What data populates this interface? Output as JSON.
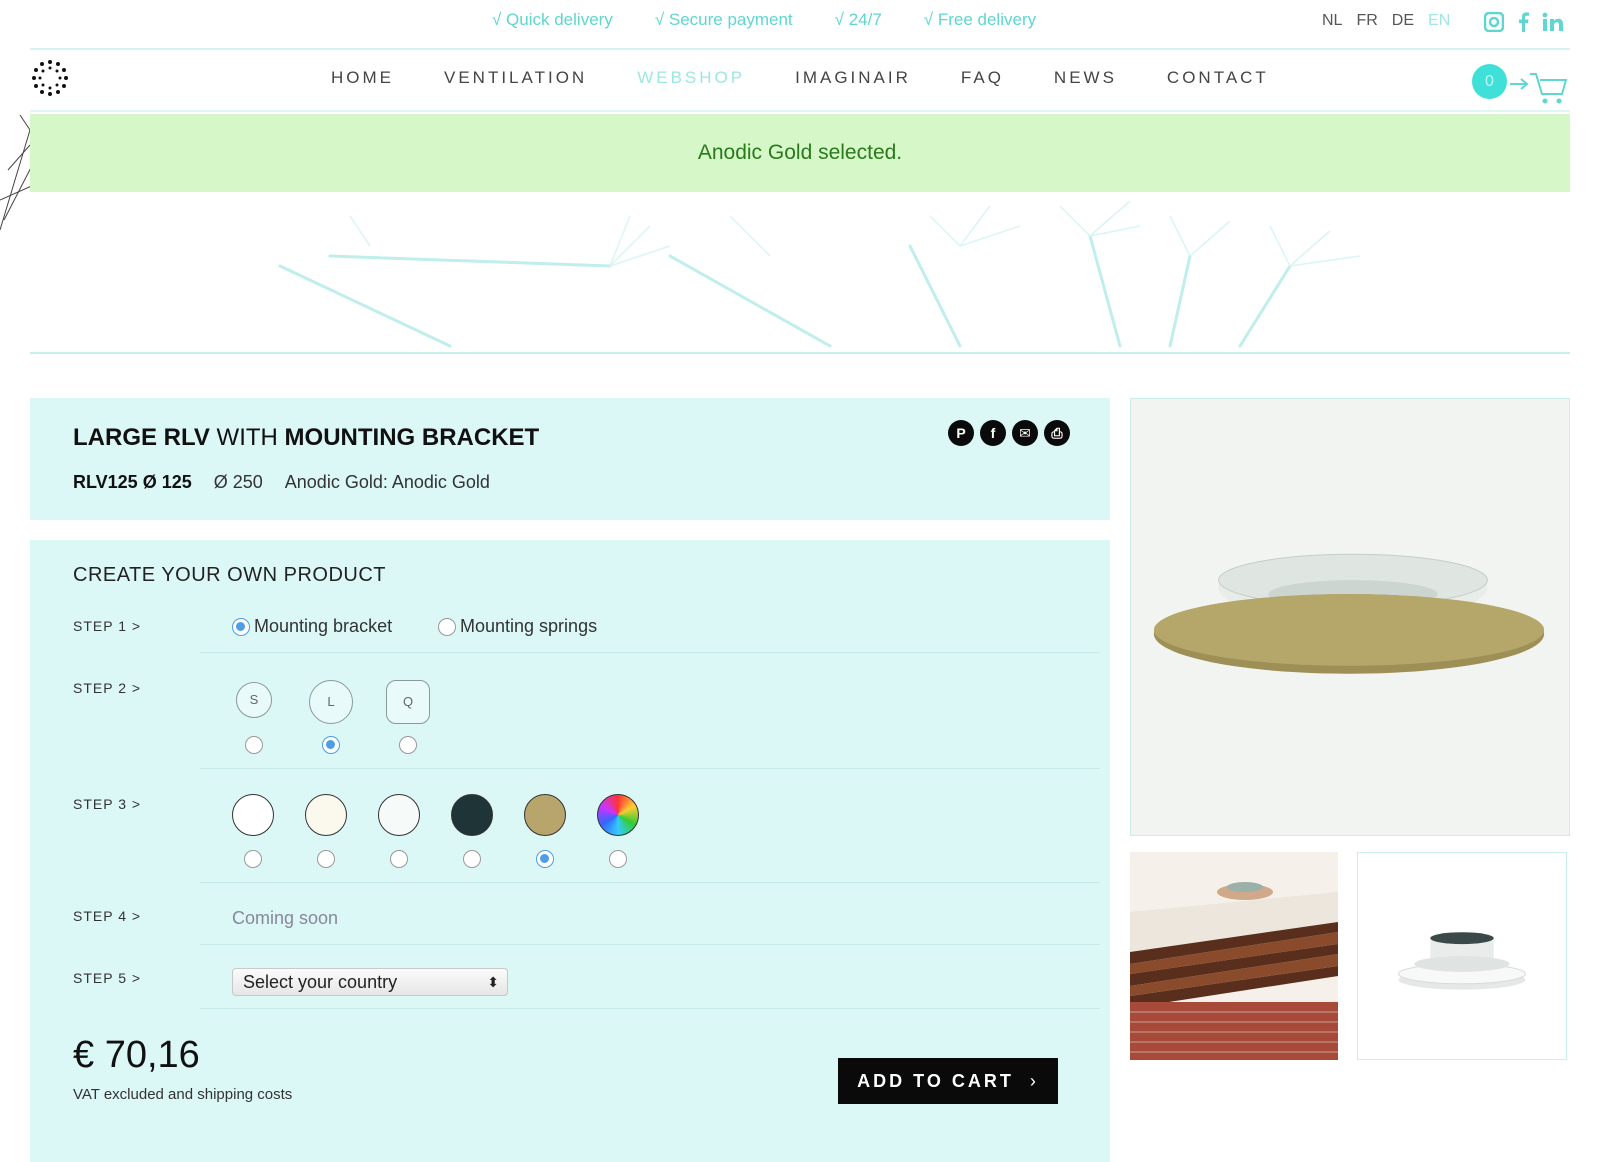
{
  "topbar": {
    "usps": [
      "√ Quick delivery",
      "√ Secure payment",
      "√ 24/7",
      "√ Free delivery"
    ],
    "languages": [
      "NL",
      "FR",
      "DE",
      "EN"
    ],
    "active_language": "EN",
    "social_icons": [
      "instagram-icon",
      "facebook-icon",
      "linkedin-icon"
    ]
  },
  "nav": {
    "items": [
      "HOME",
      "VENTILATION",
      "WEBSHOP",
      "IMAGINAIR",
      "FAQ",
      "NEWS",
      "CONTACT"
    ],
    "active": "WEBSHOP",
    "cart_count": "0"
  },
  "alert": {
    "message": "Anodic Gold selected."
  },
  "product": {
    "title_part1": "LARGE RLV",
    "title_part2": " WITH ",
    "title_part3": "MOUNTING BRACKET",
    "code": "RLV125 Ø 125",
    "diameter": "Ø 250",
    "finish": "Anodic Gold: Anodic Gold",
    "share_icons": [
      "pinterest-icon",
      "facebook-icon",
      "mail-icon",
      "print-icon"
    ]
  },
  "configurator": {
    "title": "CREATE YOUR OWN PRODUCT",
    "step1": {
      "label": "STEP 1 >",
      "options": [
        "Mounting bracket",
        "Mounting springs"
      ],
      "selected": 0
    },
    "step2": {
      "label": "STEP 2 >",
      "options": [
        "S",
        "L",
        "Q"
      ],
      "selected": 1
    },
    "step3": {
      "label": "STEP 3 >",
      "swatches": [
        "#ffffff",
        "#fbf8ee",
        "#f6fbfa",
        "#1f3437",
        "#b8a56c",
        "multicolor"
      ],
      "selected": 4
    },
    "step4": {
      "label": "STEP 4 >",
      "text": "Coming soon"
    },
    "step5": {
      "label": "STEP 5 >",
      "select_value": "Select your country"
    },
    "price": "€ 70,16",
    "vat_note": "VAT excluded and shipping costs",
    "add_to_cart": "ADD TO CART"
  },
  "colors": {
    "accent": "#5fd6cf",
    "panel": "#dbf7f6",
    "alert_bg": "#d6f8c9",
    "alert_text": "#2a7a1c",
    "radio_selected": "#4f9de8"
  }
}
